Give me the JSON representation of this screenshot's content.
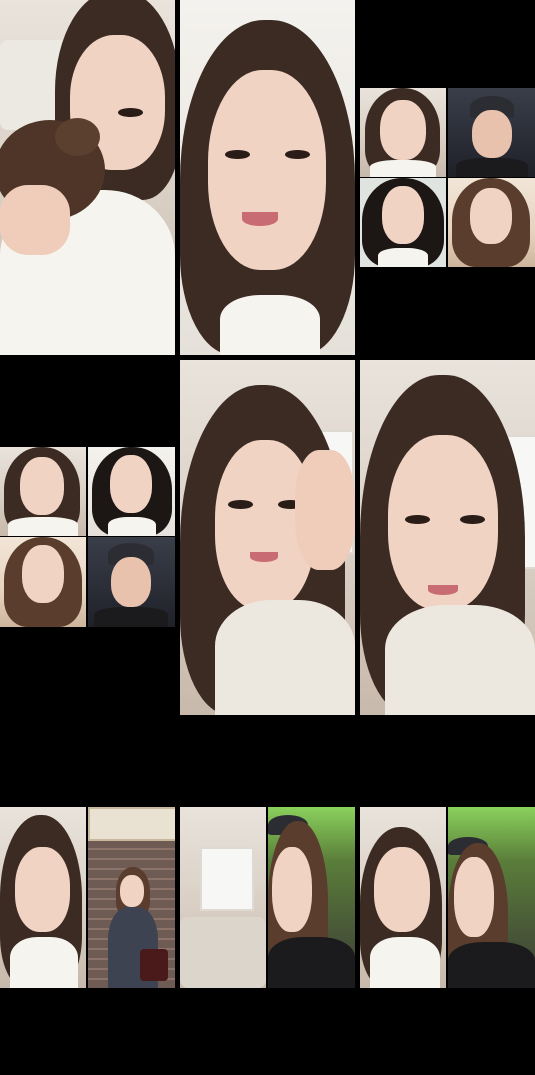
{
  "screens": [
    {
      "id": "r0c0",
      "layout": "single",
      "scene": "woman-kissing-dog"
    },
    {
      "id": "r0c1",
      "layout": "single",
      "scene": "woman-closeup"
    },
    {
      "id": "r0c2",
      "layout": "quad",
      "participants": 4
    },
    {
      "id": "r1c0",
      "layout": "quad",
      "participants": 4
    },
    {
      "id": "r1c1",
      "layout": "single",
      "scene": "woman-hand-in-hair"
    },
    {
      "id": "r1c2",
      "layout": "single",
      "scene": "woman-white-knit-top"
    },
    {
      "id": "r2c0",
      "layout": "split",
      "participants": 2
    },
    {
      "id": "r2c1",
      "layout": "split",
      "participants": 2
    },
    {
      "id": "r2c2",
      "layout": "split",
      "participants": 2
    }
  ],
  "colors": {
    "background": "#000000",
    "hair": "#3b2b22",
    "skin": "#f1d3c4",
    "shirt_white": "#f6f4ef",
    "room_wall": "#e9e3dc"
  }
}
